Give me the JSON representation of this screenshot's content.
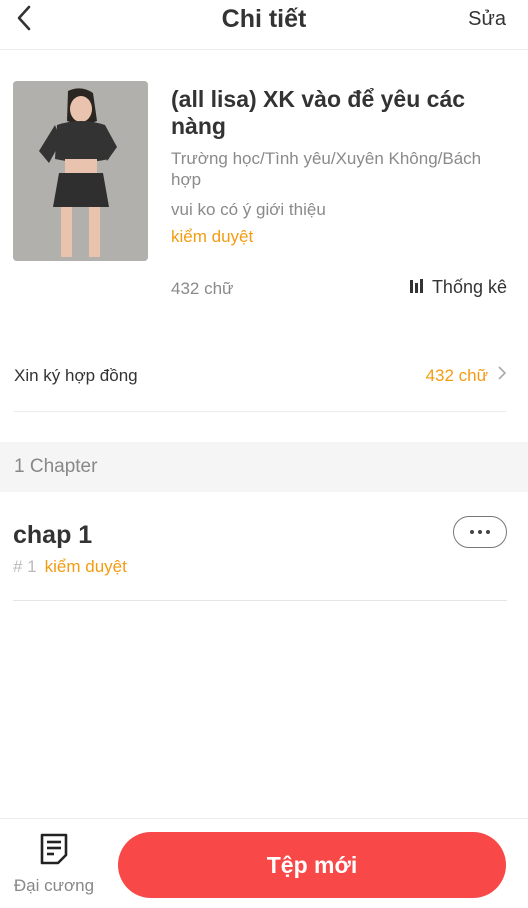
{
  "header": {
    "title": "Chi tiết",
    "edit_label": "Sửa"
  },
  "book": {
    "title": "(all lisa) XK vào để yêu các nàng",
    "genre": "Trường học/Tình yêu/Xuyên Không/Bách hợp",
    "description": "vui ko có ý giới thiệu",
    "status": "kiểm duyệt",
    "word_count": "432 chữ",
    "stats_label": "Thống kê"
  },
  "contract": {
    "label": "Xin ký hợp đồng",
    "value": "432 chữ"
  },
  "chapters": {
    "header": "1 Chapter",
    "items": [
      {
        "title": "chap 1",
        "number": "# 1",
        "status": "kiểm duyệt"
      }
    ]
  },
  "bottom": {
    "outline_label": "Đại cương",
    "new_file_label": "Tệp mới"
  },
  "colors": {
    "accent_orange": "#f39c12",
    "primary_red": "#f84848"
  }
}
